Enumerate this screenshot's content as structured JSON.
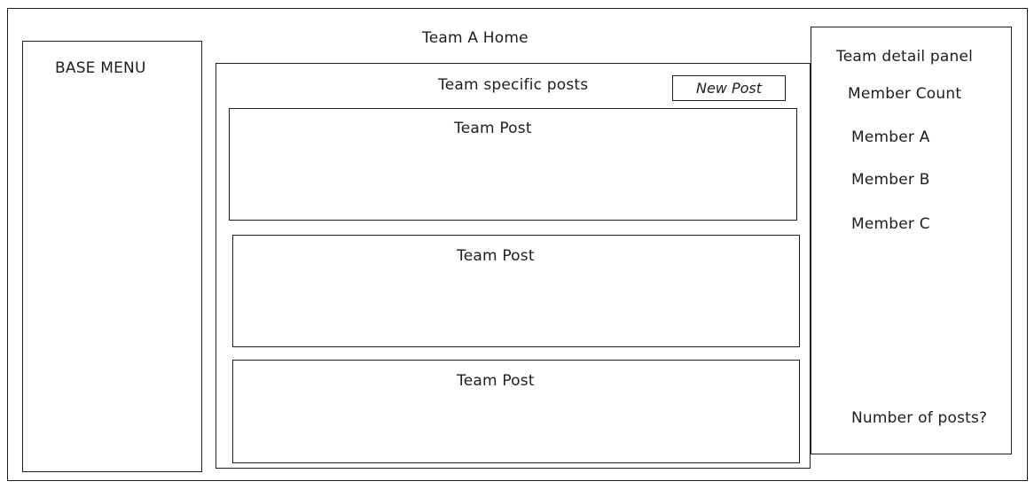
{
  "page": {
    "title": "Team A Home"
  },
  "base_menu": {
    "label": "BASE MENU"
  },
  "posts_section": {
    "heading": "Team specific posts",
    "new_post_button": "New Post",
    "posts": [
      {
        "title": "Team Post"
      },
      {
        "title": "Team Post"
      },
      {
        "title": "Team Post"
      }
    ]
  },
  "team_detail_panel": {
    "heading": "Team detail panel",
    "member_count_label": "Member Count",
    "members": [
      "Member A",
      "Member B",
      "Member C"
    ],
    "number_of_posts_label": "Number of posts?"
  },
  "colors": {
    "stroke": "#1e1e1e",
    "background": "#ffffff"
  }
}
